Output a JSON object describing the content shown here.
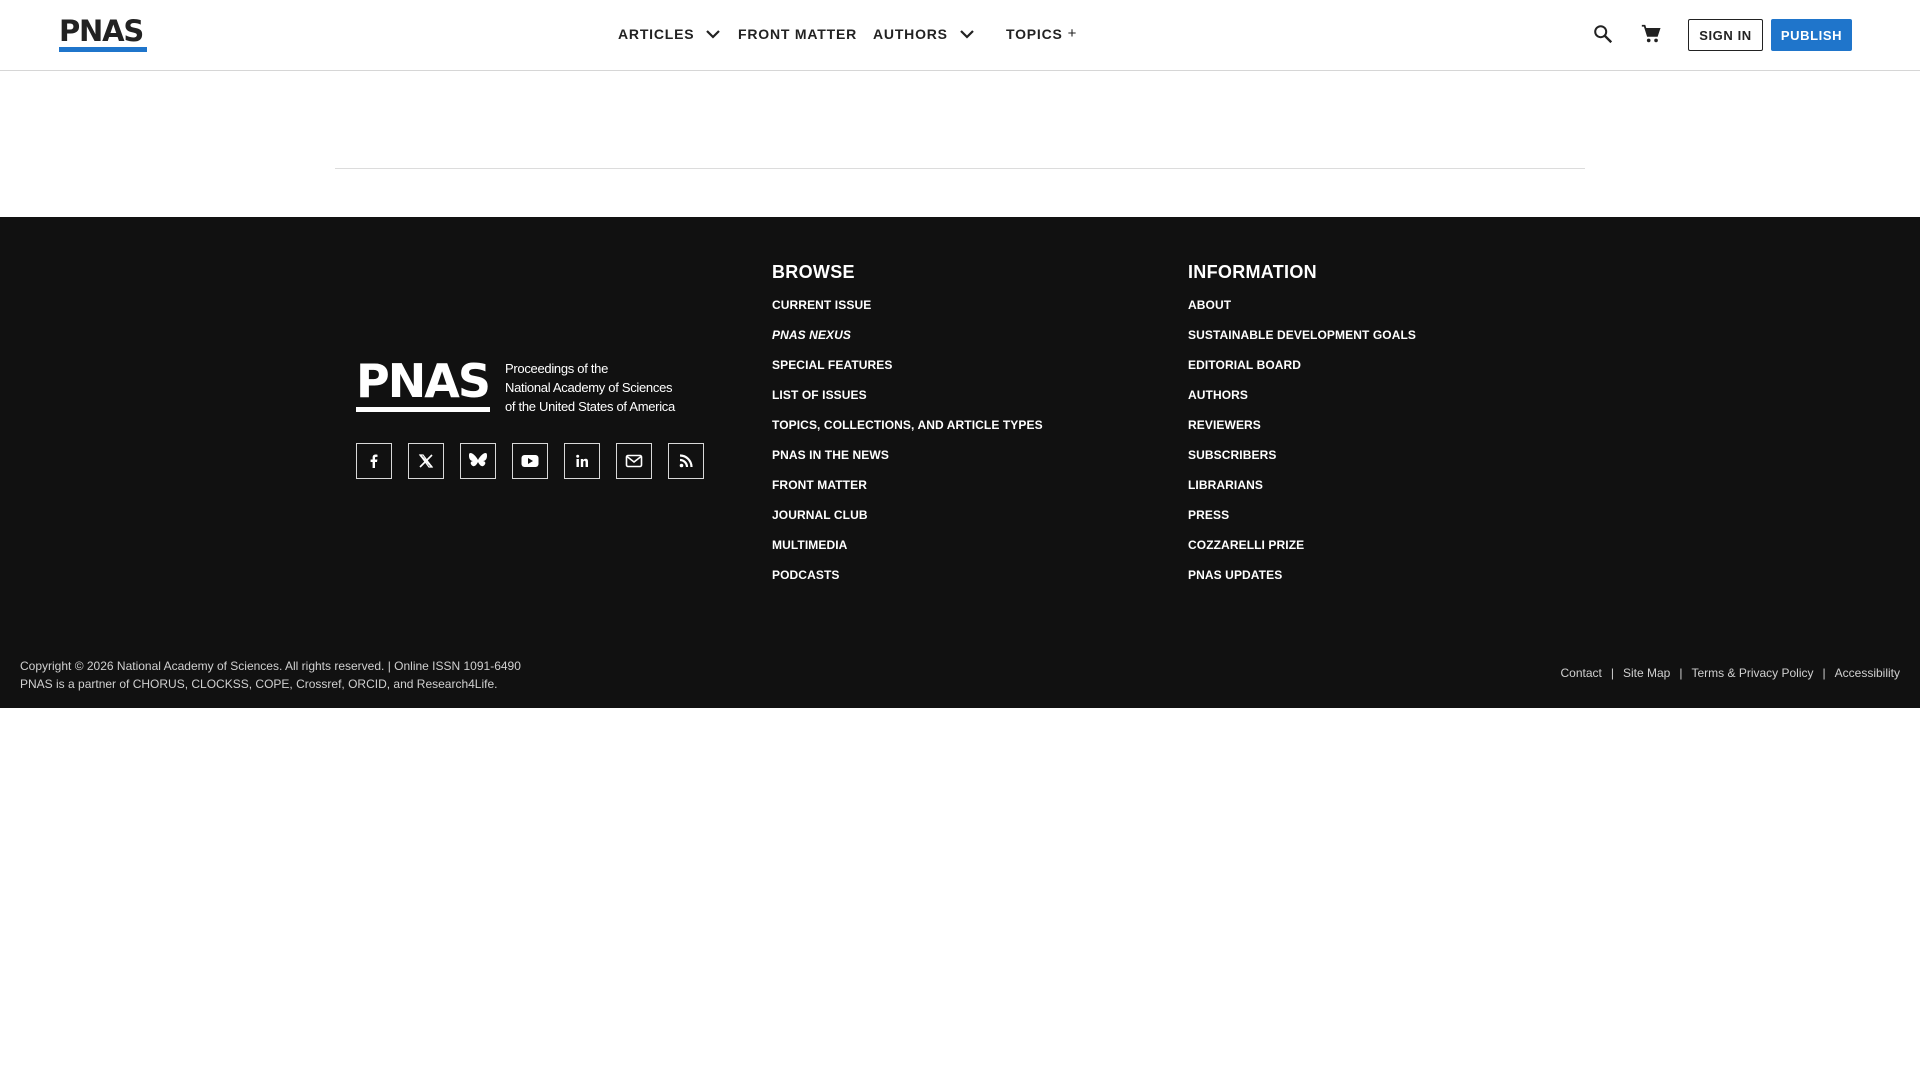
{
  "header": {
    "logo_text": "PNAS",
    "nav": {
      "articles": "ARTICLES",
      "front_matter": "FRONT MATTER",
      "authors": "AUTHORS",
      "topics": "TOPICS",
      "topics_suffix": "+"
    },
    "icons": {
      "search": "search-icon",
      "cart": "cart-icon",
      "dropdown": "chevron-down-icon"
    },
    "sign_in": "SIGN IN",
    "publish": "PUBLISH",
    "colors": {
      "accent": "#1f75cb",
      "text": "#222222"
    }
  },
  "footer": {
    "org_logo": {
      "mark": "PNAS",
      "lines": [
        "Proceedings of the",
        "National Academy of Sciences",
        "of the United States of America"
      ]
    },
    "social_icons": [
      "facebook-icon",
      "x-icon",
      "bluesky-icon",
      "youtube-icon",
      "linkedin-icon",
      "email-icon",
      "rss-icon"
    ],
    "browse": {
      "heading": "BROWSE",
      "items": [
        "CURRENT ISSUE",
        "PNAS NEXUS",
        "SPECIAL FEATURES",
        "LIST OF ISSUES",
        "TOPICS, COLLECTIONS, AND ARTICLE TYPES",
        "PNAS IN THE NEWS",
        "FRONT MATTER",
        "JOURNAL CLUB",
        "MULTIMEDIA",
        "PODCASTS"
      ]
    },
    "information": {
      "heading": "INFORMATION",
      "items": [
        "ABOUT",
        "SUSTAINABLE DEVELOPMENT GOALS",
        "EDITORIAL BOARD",
        "AUTHORS",
        "REVIEWERS",
        "SUBSCRIBERS",
        "LIBRARIANS",
        "PRESS",
        "COZZARELLI PRIZE",
        "PNAS UPDATES"
      ]
    },
    "colors": {
      "background": "#111111",
      "text": "#ffffff"
    }
  },
  "sub_footer": {
    "copyright": "Copyright © 2026 National Academy of Sciences. All rights reserved. | Online ISSN 1091-6490",
    "partners": "PNAS is a partner of CHORUS, CLOCKSS, COPE, Crossref, ORCID, and Research4Life.",
    "links": [
      "Contact",
      "Site Map",
      "Terms & Privacy Policy",
      "Accessibility"
    ],
    "separator": "|"
  }
}
